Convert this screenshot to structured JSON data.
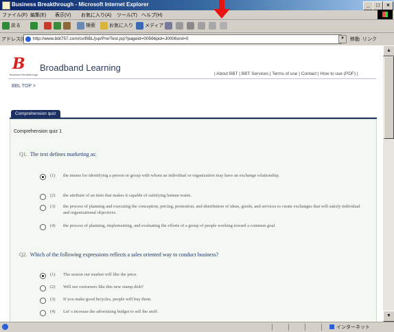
{
  "window": {
    "title": "Business Breakthrough - Microsoft Internet Explorer"
  },
  "menubar": [
    "ファイル(F)",
    "編集(E)",
    "表示(V)",
    "お気に入り(A)",
    "ツール(T)",
    "ヘルプ(H)"
  ],
  "toolbar": {
    "back": "戻る",
    "search": "検索",
    "favorites": "お気に入り",
    "media": "メディア"
  },
  "address": {
    "label": "アドレス(D)",
    "url": "http://www.bbt757.com/cv/BBL/jsp/Pre/Test.jsp?pageId=00566pid=J0006ord=0",
    "go": "移動",
    "links": "リンク"
  },
  "header": {
    "logo_letter": "B",
    "logo_sub": "Business Breakthrough",
    "brand": "Broadband Learning",
    "links": "| About BBT | BBT Services | Terms of use | Contact | How to use (PDF) |",
    "breadcrumb": "BBL TOP >"
  },
  "tab": "Comprehension quiz",
  "quiz": {
    "title": "Comprehension quiz 1",
    "questions": [
      {
        "num": "Q1.",
        "text": "The text defines marketing as:",
        "options": [
          {
            "num": "(1)",
            "text": "the means for identifying a person or group with whom an individual or organization may have an exchange relationship."
          },
          {
            "num": "(2)",
            "text": "the attribute of an item that makes it capable of satisfying human wants."
          },
          {
            "num": "(3)",
            "text": "the process of planning and executing the conception, pricing, promotion, and distribution of ideas, goods, and services to create exchanges that will satisfy individual and organizational objectives."
          },
          {
            "num": "(4)",
            "text": "the process of planning, implementing, and evaluating the efforts of a group of people working toward a common goal."
          }
        ]
      },
      {
        "num": "Q2.",
        "text": "Which of the following expressions reflects a sales oriented way to conduct business?",
        "options": [
          {
            "num": "(1)",
            "text": "The season our market will like the price."
          },
          {
            "num": "(2)",
            "text": "Will our customers like this new stamp dish?"
          },
          {
            "num": "(3)",
            "text": "If you make good bicycles, people will buy them."
          },
          {
            "num": "(4)",
            "text": "Let' s increase the advertising budget to sell the stuff."
          }
        ]
      }
    ],
    "selected": [
      "Q1-1",
      "Q2-1"
    ]
  },
  "status": {
    "zone": "インターネット"
  }
}
